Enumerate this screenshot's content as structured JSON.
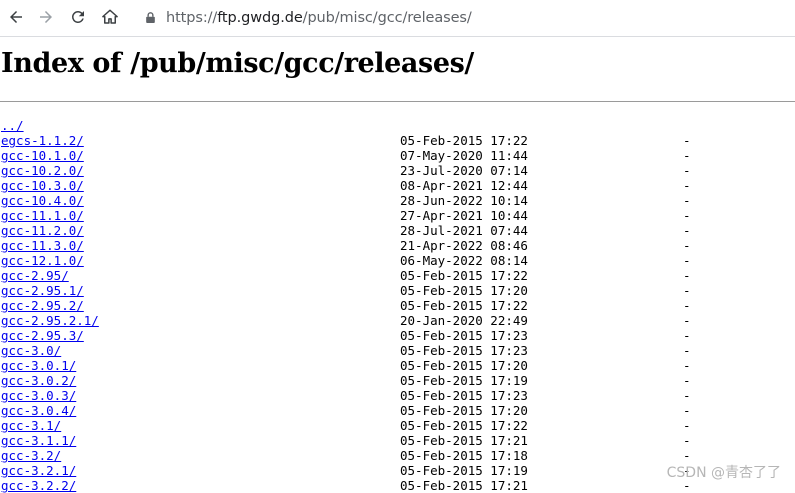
{
  "browser": {
    "url_scheme": "https://",
    "url_domain": "ftp.gwdg.de",
    "url_path": "/pub/misc/gcc/releases/"
  },
  "page": {
    "title": "Index of /pub/misc/gcc/releases/"
  },
  "parent_link": "../",
  "entries": [
    {
      "name": "egcs-1.1.2/",
      "date": "05-Feb-2015 17:22",
      "size": "-"
    },
    {
      "name": "gcc-10.1.0/",
      "date": "07-May-2020 11:44",
      "size": "-"
    },
    {
      "name": "gcc-10.2.0/",
      "date": "23-Jul-2020 07:14",
      "size": "-"
    },
    {
      "name": "gcc-10.3.0/",
      "date": "08-Apr-2021 12:44",
      "size": "-"
    },
    {
      "name": "gcc-10.4.0/",
      "date": "28-Jun-2022 10:14",
      "size": "-"
    },
    {
      "name": "gcc-11.1.0/",
      "date": "27-Apr-2021 10:44",
      "size": "-"
    },
    {
      "name": "gcc-11.2.0/",
      "date": "28-Jul-2021 07:44",
      "size": "-"
    },
    {
      "name": "gcc-11.3.0/",
      "date": "21-Apr-2022 08:46",
      "size": "-"
    },
    {
      "name": "gcc-12.1.0/",
      "date": "06-May-2022 08:14",
      "size": "-"
    },
    {
      "name": "gcc-2.95/",
      "date": "05-Feb-2015 17:22",
      "size": "-"
    },
    {
      "name": "gcc-2.95.1/",
      "date": "05-Feb-2015 17:20",
      "size": "-"
    },
    {
      "name": "gcc-2.95.2/",
      "date": "05-Feb-2015 17:22",
      "size": "-"
    },
    {
      "name": "gcc-2.95.2.1/",
      "date": "20-Jan-2020 22:49",
      "size": "-"
    },
    {
      "name": "gcc-2.95.3/",
      "date": "05-Feb-2015 17:23",
      "size": "-"
    },
    {
      "name": "gcc-3.0/",
      "date": "05-Feb-2015 17:23",
      "size": "-"
    },
    {
      "name": "gcc-3.0.1/",
      "date": "05-Feb-2015 17:20",
      "size": "-"
    },
    {
      "name": "gcc-3.0.2/",
      "date": "05-Feb-2015 17:19",
      "size": "-"
    },
    {
      "name": "gcc-3.0.3/",
      "date": "05-Feb-2015 17:23",
      "size": "-"
    },
    {
      "name": "gcc-3.0.4/",
      "date": "05-Feb-2015 17:20",
      "size": "-"
    },
    {
      "name": "gcc-3.1/",
      "date": "05-Feb-2015 17:22",
      "size": "-"
    },
    {
      "name": "gcc-3.1.1/",
      "date": "05-Feb-2015 17:21",
      "size": "-"
    },
    {
      "name": "gcc-3.2/",
      "date": "05-Feb-2015 17:18",
      "size": "-"
    },
    {
      "name": "gcc-3.2.1/",
      "date": "05-Feb-2015 17:19",
      "size": "-"
    },
    {
      "name": "gcc-3.2.2/",
      "date": "05-Feb-2015 17:21",
      "size": "-"
    }
  ],
  "watermark": "CSDN @青杏了了",
  "icons": {
    "back": "arrow-left-icon",
    "forward": "arrow-right-icon",
    "reload": "reload-icon",
    "home": "home-icon",
    "lock": "lock-icon"
  },
  "colors": {
    "link": "#0000ee",
    "toolbar_icon": "#5f6368",
    "toolbar_icon_disabled": "#bdc1c6"
  }
}
